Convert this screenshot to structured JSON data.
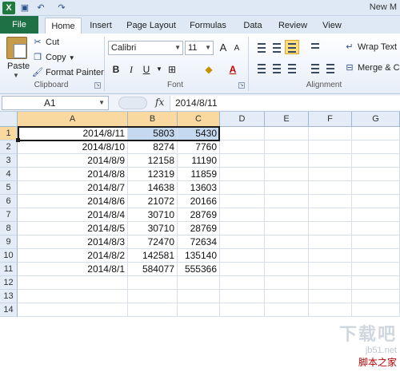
{
  "window": {
    "title": "New M",
    "app_icon_label": "X"
  },
  "quick_access": {
    "save_icon": "save-icon",
    "undo_icon": "undo-icon",
    "redo_icon": "redo-icon"
  },
  "tabs": [
    {
      "label": "File"
    },
    {
      "label": "Home"
    },
    {
      "label": "Insert"
    },
    {
      "label": "Page Layout"
    },
    {
      "label": "Formulas"
    },
    {
      "label": "Data"
    },
    {
      "label": "Review"
    },
    {
      "label": "View"
    }
  ],
  "ribbon": {
    "clipboard": {
      "group_label": "Clipboard",
      "paste_label": "Paste",
      "cut_label": "Cut",
      "copy_label": "Copy",
      "format_painter_label": "Format Painter"
    },
    "font": {
      "group_label": "Font",
      "font_name": "Calibri",
      "font_size": "11",
      "bold": "B",
      "italic": "I",
      "underline": "U",
      "grow": "A",
      "shrink": "A"
    },
    "alignment": {
      "group_label": "Alignment",
      "wrap_text_label": "Wrap Text",
      "merge_label": "Merge & Ce"
    }
  },
  "formula_bar": {
    "name_box": "A1",
    "fx_label": "fx",
    "formula": "2014/8/11"
  },
  "columns": [
    "A",
    "B",
    "C",
    "D",
    "E",
    "F",
    "G"
  ],
  "rows": [
    {
      "num": "1",
      "a": "2014/8/11",
      "b": "5803",
      "c": "5430"
    },
    {
      "num": "2",
      "a": "2014/8/10",
      "b": "8274",
      "c": "7760"
    },
    {
      "num": "3",
      "a": "2014/8/9",
      "b": "12158",
      "c": "11190"
    },
    {
      "num": "4",
      "a": "2014/8/8",
      "b": "12319",
      "c": "11859"
    },
    {
      "num": "5",
      "a": "2014/8/7",
      "b": "14638",
      "c": "13603"
    },
    {
      "num": "6",
      "a": "2014/8/6",
      "b": "21072",
      "c": "20166"
    },
    {
      "num": "7",
      "a": "2014/8/4",
      "b": "30710",
      "c": "28769"
    },
    {
      "num": "8",
      "a": "2014/8/5",
      "b": "30710",
      "c": "28769"
    },
    {
      "num": "9",
      "a": "2014/8/3",
      "b": "72470",
      "c": "72634"
    },
    {
      "num": "10",
      "a": "2014/8/2",
      "b": "142581",
      "c": "135140"
    },
    {
      "num": "11",
      "a": "2014/8/1",
      "b": "584077",
      "c": "555366"
    },
    {
      "num": "12",
      "a": "",
      "b": "",
      "c": ""
    },
    {
      "num": "13",
      "a": "",
      "b": "",
      "c": ""
    },
    {
      "num": "14",
      "a": "",
      "b": "",
      "c": ""
    }
  ],
  "watermark": {
    "site": "jb51.net",
    "brand": "脚本之家",
    "logo_text": "下载吧"
  },
  "colors": {
    "file_tab": "#1e7145",
    "selection_highlight": "#c5daf0",
    "header_selected": "#f9d99f",
    "align_selected": "#fddf7f"
  }
}
